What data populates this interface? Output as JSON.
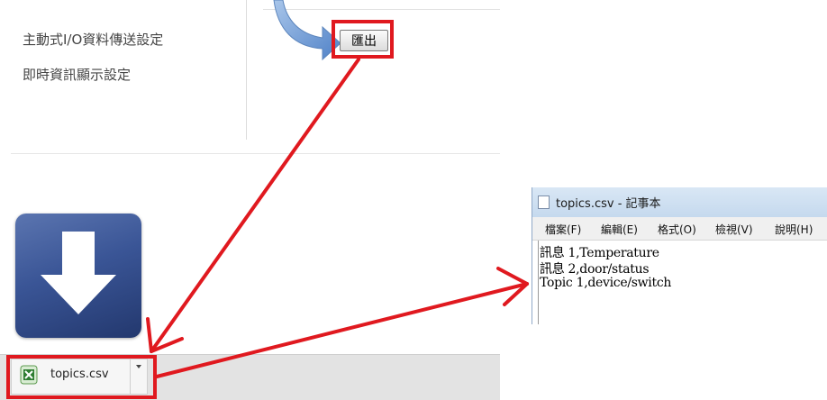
{
  "settings": {
    "menu_items": [
      "主動式I/O資料傳送設定",
      "即時資訊顯示設定"
    ],
    "export_button_label": "匯出"
  },
  "download_shelf": {
    "file_name": "topics.csv",
    "file_icon": "excel-csv-file-icon",
    "caret_icon": "caret-down-icon"
  },
  "notepad": {
    "title": "topics.csv - 記事本",
    "menu": [
      "檔案(F)",
      "編輯(E)",
      "格式(O)",
      "檢視(V)",
      "說明(H)"
    ],
    "lines": [
      "訊息 1,Temperature",
      "訊息 2,door/status",
      "Topic 1,device/switch"
    ]
  },
  "icons": {
    "decor_arrow": "curved-arrow-icon",
    "download": "download-arrow-icon"
  },
  "colors": {
    "annotation_red": "#e0191f",
    "download_icon_blue": "#3a5596"
  }
}
